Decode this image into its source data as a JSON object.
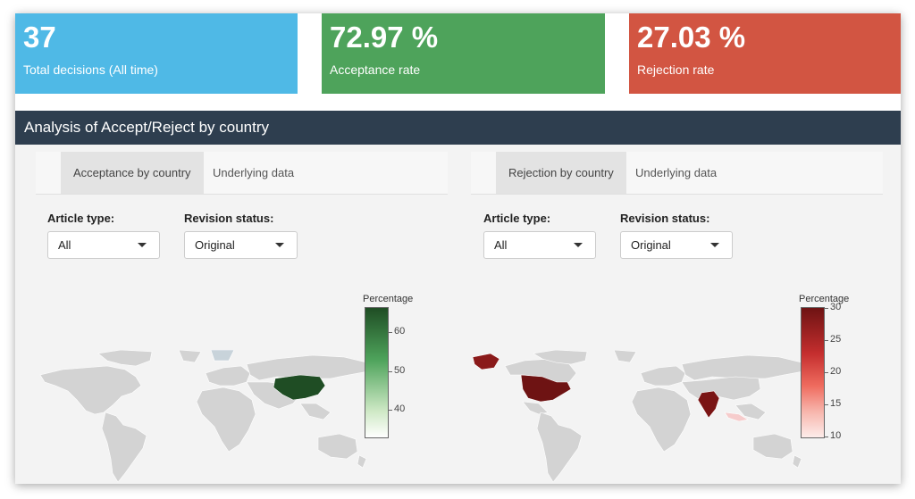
{
  "value_boxes": [
    {
      "value": "37",
      "label": "Total decisions (All time)",
      "color": "#4fb9e6"
    },
    {
      "value": "72.97 %",
      "label": "Acceptance rate",
      "color": "#4ea35b"
    },
    {
      "value": "27.03 %",
      "label": "Rejection rate",
      "color": "#d25542"
    }
  ],
  "panel": {
    "title": "Analysis of Accept/Reject by country",
    "header_color": "#2e3e4f"
  },
  "left": {
    "tabs": [
      "Acceptance by country",
      "Underlying data"
    ],
    "active_tab": "Acceptance by country",
    "filters": [
      {
        "label": "Article type:",
        "selected": "All"
      },
      {
        "label": "Revision status:",
        "selected": "Original"
      }
    ],
    "map": {
      "colorbar_title": "Percentage",
      "ticks": [
        "60",
        "50",
        "40"
      ],
      "highlighted": [
        {
          "country": "China",
          "color": "#1f4d24"
        }
      ],
      "scale_colors": [
        "#1f4d24",
        "#ffffff"
      ]
    }
  },
  "right": {
    "tabs": [
      "Rejection by country",
      "Underlying data"
    ],
    "active_tab": "Rejection by country",
    "filters": [
      {
        "label": "Article type:",
        "selected": "All"
      },
      {
        "label": "Revision status:",
        "selected": "Original"
      }
    ],
    "map": {
      "colorbar_title": "Percentage",
      "ticks": [
        "30",
        "25",
        "20",
        "15",
        "10"
      ],
      "highlighted": [
        {
          "country": "United States",
          "color": "#6e1313"
        },
        {
          "country": "India",
          "color": "#7a1414"
        }
      ],
      "scale_colors": [
        "#6e1313",
        "#fdecea"
      ]
    }
  }
}
